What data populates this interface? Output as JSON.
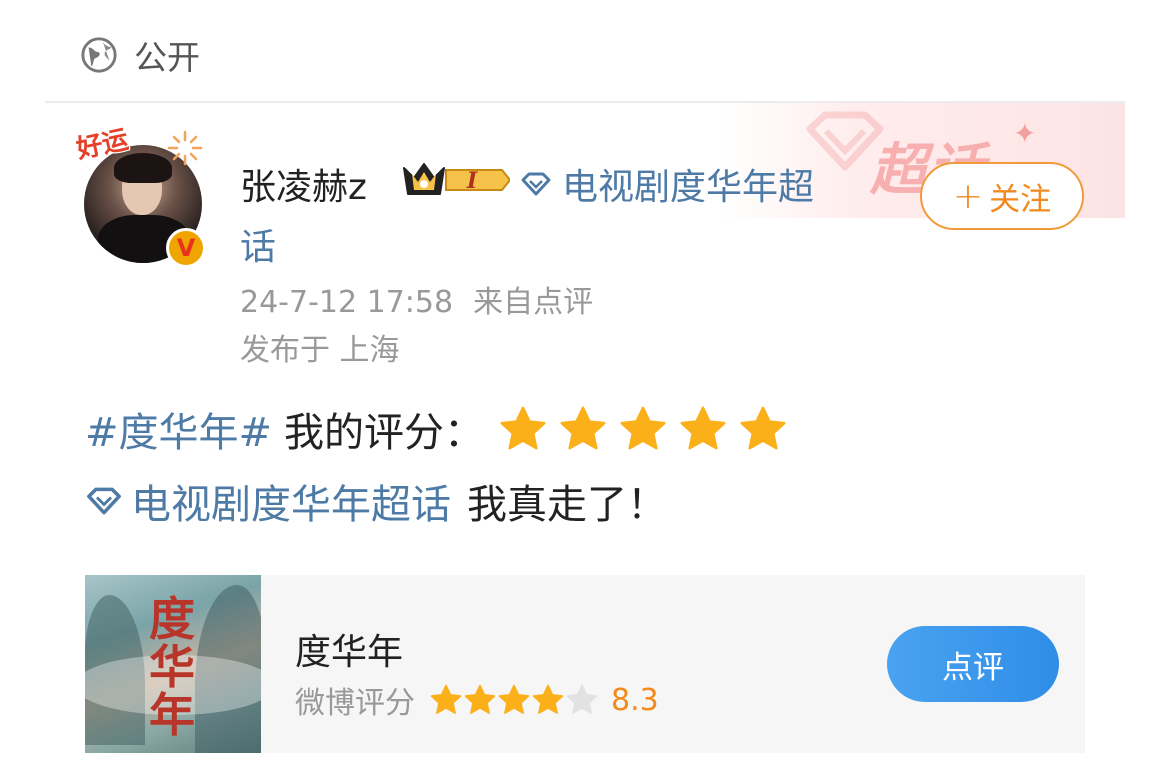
{
  "visibility": {
    "label": "公开",
    "icon": "globe-icon"
  },
  "banner": {
    "watermark": "超话"
  },
  "post": {
    "author": {
      "name": "张凌赫z",
      "avatar_tag": "好运",
      "verified_badge": "V",
      "level_badge": "I"
    },
    "super_topic": {
      "label_part1": "电视剧度华年超",
      "label_part2": "话"
    },
    "follow_button": {
      "plus": "+",
      "label": "关注"
    },
    "timestamp": "24-7-12 17:58",
    "source": "来自点评",
    "location": "发布于 上海",
    "content": {
      "hashtag": "#度华年#",
      "rating_text": "我的评分：",
      "rating_stars": 5,
      "topic_link": "电视剧度华年超话",
      "tail_text": "我真走了！"
    }
  },
  "review_card": {
    "title": "度华年",
    "poster_title": "度华年",
    "rating_label": "微博评分",
    "score": "8.3",
    "star_fill": 4,
    "button_label": "点评"
  },
  "colors": {
    "link": "#4e7aa6",
    "orange": "#f08a1e",
    "star": "#fbb01a",
    "button_blue": "#3a98ec"
  }
}
